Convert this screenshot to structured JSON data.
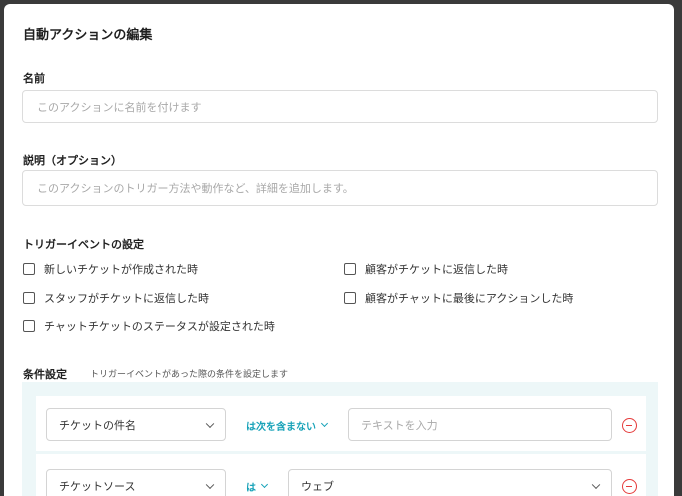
{
  "modal": {
    "title": "自動アクションの編集"
  },
  "name": {
    "label": "名前",
    "placeholder": "このアクションに名前を付けます"
  },
  "description": {
    "label": "説明（オプション）",
    "placeholder": "このアクションのトリガー方法や動作など、詳細を追加します。"
  },
  "trigger": {
    "label": "トリガーイベントの設定",
    "options": [
      {
        "label": "新しいチケットが作成された時",
        "checked": false
      },
      {
        "label": "顧客がチケットに返信した時",
        "checked": false
      },
      {
        "label": "スタッフがチケットに返信した時",
        "checked": false
      },
      {
        "label": "顧客がチャットに最後にアクションした時",
        "checked": false
      },
      {
        "label": "チャットチケットのステータスが設定された時",
        "checked": false
      }
    ]
  },
  "conditions": {
    "label": "条件設定",
    "description": "トリガーイベントがあった際の条件を設定します",
    "rows": [
      {
        "field": "チケットの件名",
        "operator": "は次を含まない",
        "value_placeholder": "テキストを入力"
      },
      {
        "field": "チケットソース",
        "operator": "は",
        "value": "ウェブ"
      }
    ]
  },
  "colors": {
    "accent": "#17a2b8",
    "danger": "#e53b3b",
    "panel_bg": "#edf7f8"
  }
}
